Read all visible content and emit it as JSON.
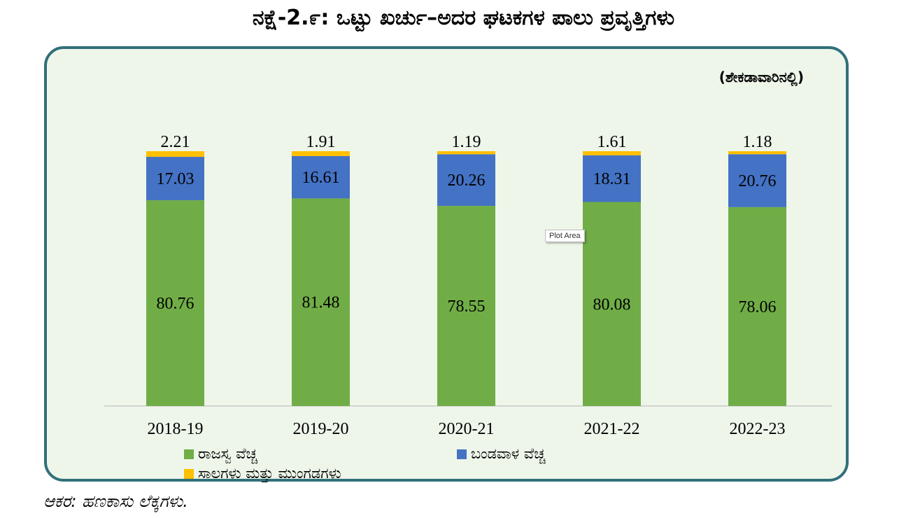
{
  "title": "ನಕ್ಷೆ-2.೯: ಒಟ್ಟು ಖರ್ಚು–ಅದರ ಘಟಕಗಳ ಪಾಲು ಪ್ರವೃತ್ತಿಗಳು",
  "unit_label": "(ಶೇಕಡಾವಾರಿನಲ್ಲಿ)",
  "tooltip": "Plot Area",
  "source": "ಆಕರ: ಹಣಕಾಸು ಲೆಕ್ಕಗಳು.",
  "colors": {
    "revenue": "#70ad47",
    "capital": "#4472c4",
    "loans": "#ffc000",
    "frame_border": "#31707a",
    "plot_bg": "#eef6ea"
  },
  "chart_data": {
    "type": "bar",
    "stacked": true,
    "categories": [
      "2018-19",
      "2019-20",
      "2020-21",
      "2021-22",
      "2022-23"
    ],
    "series": [
      {
        "name": "ರಾಜಸ್ವ ವೆಚ್ಚ",
        "values": [
          80.76,
          81.48,
          78.55,
          80.08,
          78.06
        ]
      },
      {
        "name": "ಬಂಡವಾಳ ವೆಚ್ಚ",
        "values": [
          17.03,
          16.61,
          20.26,
          18.31,
          20.76
        ]
      },
      {
        "name": "ಸಾಲಗಳು ಮತ್ತು ಮುಂಗಡಗಳು",
        "values": [
          2.21,
          1.91,
          1.19,
          1.61,
          1.18
        ]
      }
    ],
    "ylim": [
      0,
      100
    ],
    "grid": false,
    "legend": "bottom"
  }
}
